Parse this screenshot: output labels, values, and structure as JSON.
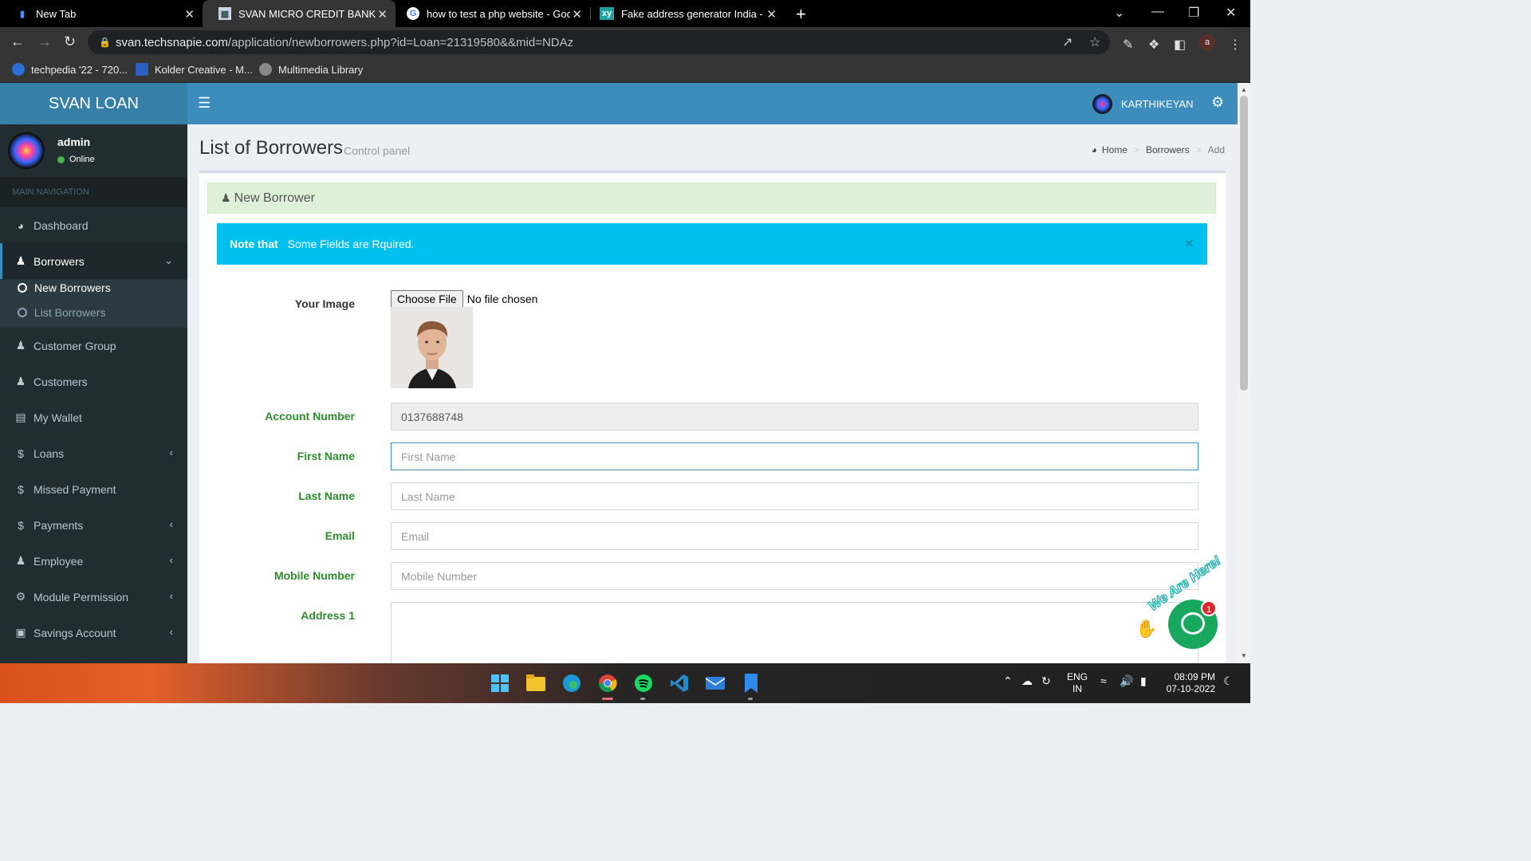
{
  "browser": {
    "tabs": [
      {
        "title": "New Tab",
        "active": false
      },
      {
        "title": "SVAN MICRO CREDIT BANK",
        "active": true
      },
      {
        "title": "how to test a php website - Goo",
        "active": false
      },
      {
        "title": "Fake address generator India - Ra",
        "active": false
      }
    ],
    "url_host": "svan.techsnapie.com",
    "url_path": "/application/newborrowers.php?id=Loan=21319580&&mid=NDAz",
    "profile_initial": "a",
    "bookmarks": [
      {
        "label": "techpedia '22 - 720..."
      },
      {
        "label": "Kolder Creative - M..."
      },
      {
        "label": "Multimedia Library"
      }
    ]
  },
  "header": {
    "logo": "SVAN LOAN",
    "username": "KARTHIKEYAN"
  },
  "sidebar": {
    "user": {
      "name": "admin",
      "status": "Online"
    },
    "nav_header": "MAIN NAVIGATION",
    "items": [
      {
        "label": "Dashboard",
        "icon": "dashboard-icon"
      },
      {
        "label": "Borrowers",
        "icon": "users-icon"
      },
      {
        "label": "Customer Group",
        "icon": "users-icon"
      },
      {
        "label": "Customers",
        "icon": "users-icon"
      },
      {
        "label": "My Wallet",
        "icon": "book-icon"
      },
      {
        "label": "Loans",
        "icon": "dollar-icon"
      },
      {
        "label": "Missed Payment",
        "icon": "dollar-icon"
      },
      {
        "label": "Payments",
        "icon": "dollar-icon"
      },
      {
        "label": "Employee",
        "icon": "user-icon"
      },
      {
        "label": "Module Permission",
        "icon": "gears-icon"
      },
      {
        "label": "Savings Account",
        "icon": "money-icon"
      }
    ],
    "submenu": [
      {
        "label": "New Borrowers",
        "active": true
      },
      {
        "label": "List Borrowers",
        "active": false
      }
    ]
  },
  "page": {
    "title": "List of Borrowers",
    "subtitle": "Control panel",
    "breadcrumb": [
      "Home",
      "Borrowers",
      "Add"
    ]
  },
  "form": {
    "box_title": "New Borrower",
    "alert_bold": "Note that",
    "alert_text": "Some Fields are Rquired.",
    "image_label": "Your Image",
    "choose_file": "Choose File",
    "no_file": "No file chosen",
    "account_number_label": "Account Number",
    "account_number_value": "0137688748",
    "first_name_label": "First Name",
    "first_name_placeholder": "First Name",
    "last_name_label": "Last Name",
    "last_name_placeholder": "Last Name",
    "email_label": "Email",
    "email_placeholder": "Email",
    "mobile_label": "Mobile Number",
    "mobile_placeholder": "Mobile Number",
    "address1_label": "Address 1"
  },
  "chat": {
    "tagline": "We Are Here!",
    "badge": "1"
  },
  "taskbar": {
    "lang_line1": "ENG",
    "lang_line2": "IN",
    "time": "08:09 PM",
    "date": "07-10-2022"
  }
}
